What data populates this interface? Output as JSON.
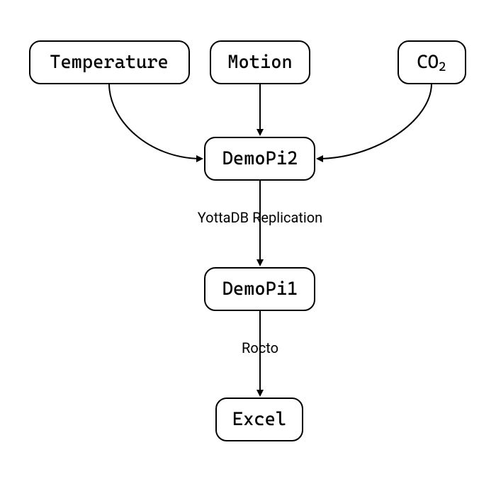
{
  "chart_data": {
    "type": "flowchart",
    "nodes": [
      {
        "id": "temperature",
        "label": "Temperature"
      },
      {
        "id": "motion",
        "label": "Motion"
      },
      {
        "id": "co2",
        "label": "CO₂"
      },
      {
        "id": "demopi2",
        "label": "DemoPi2"
      },
      {
        "id": "demopi1",
        "label": "DemoPi1"
      },
      {
        "id": "excel",
        "label": "Excel"
      }
    ],
    "edges": [
      {
        "from": "temperature",
        "to": "demopi2",
        "label": ""
      },
      {
        "from": "motion",
        "to": "demopi2",
        "label": ""
      },
      {
        "from": "co2",
        "to": "demopi2",
        "label": ""
      },
      {
        "from": "demopi2",
        "to": "demopi1",
        "label": "YottaDB Replication"
      },
      {
        "from": "demopi1",
        "to": "excel",
        "label": "Rocto"
      }
    ]
  },
  "nodes": {
    "temperature": "Temperature",
    "motion": "Motion",
    "co2": "CO",
    "co2_sub": "2",
    "demopi2": "DemoPi2",
    "demopi1": "DemoPi1",
    "excel": "Excel"
  },
  "edges": {
    "yottadb": "YottaDB Replication",
    "rocto": "Rocto"
  }
}
